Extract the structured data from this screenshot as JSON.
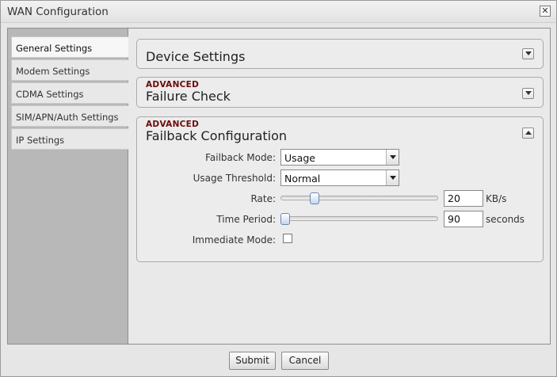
{
  "window": {
    "title": "WAN Configuration"
  },
  "sidebar": {
    "items": [
      {
        "label": "General Settings",
        "active": true
      },
      {
        "label": "Modem Settings"
      },
      {
        "label": "CDMA Settings"
      },
      {
        "label": "SIM/APN/Auth Settings"
      },
      {
        "label": "IP Settings"
      }
    ]
  },
  "panels": {
    "device": {
      "title": "Device Settings",
      "state": "collapsed"
    },
    "failure": {
      "tag": "ADVANCED",
      "title": "Failure Check",
      "state": "collapsed"
    },
    "failback": {
      "tag": "ADVANCED",
      "title": "Failback Configuration",
      "state": "expanded",
      "fields": {
        "mode": {
          "label": "Failback Mode:",
          "value": "Usage"
        },
        "threshold": {
          "label": "Usage Threshold:",
          "value": "Normal"
        },
        "rate": {
          "label": "Rate:",
          "value": "20",
          "unit": "KB/s",
          "slider_fraction": 0.2
        },
        "period": {
          "label": "Time Period:",
          "value": "90",
          "unit": "seconds",
          "slider_fraction": 0.0
        },
        "immediate": {
          "label": "Immediate Mode:",
          "checked": false
        }
      }
    }
  },
  "footer": {
    "submit_label": "Submit",
    "cancel_label": "Cancel"
  },
  "icons": {
    "close": "close-icon",
    "expand": "chevron-down-icon",
    "collapse": "chevron-up-icon",
    "dropdown": "dropdown-arrow-icon"
  }
}
